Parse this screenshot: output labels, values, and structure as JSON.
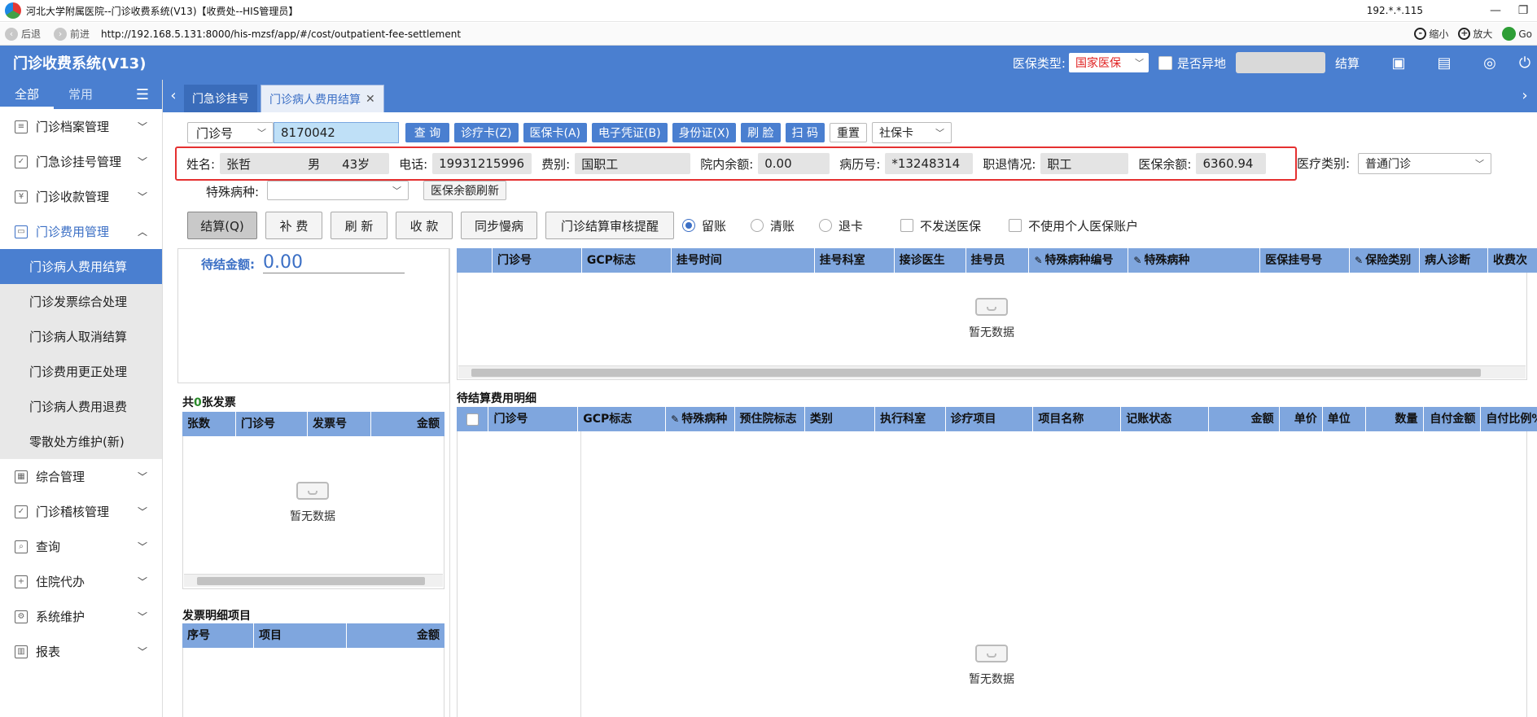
{
  "window": {
    "title": "河北大学附属医院--门诊收费系统(V13)【收费处--HIS管理员】",
    "ip": "192.*.*.115"
  },
  "addr": {
    "back": "后退",
    "forward": "前进",
    "url": "http://192.168.5.131:8000/his-mzsf/app/#/cost/outpatient-fee-settlement",
    "zoom_out": "缩小",
    "zoom_in": "放大",
    "go": "Go"
  },
  "header": {
    "title": "门诊收费系统(V13)",
    "insurance_type_label": "医保类型:",
    "insurance_type_value": "国家医保",
    "remote_label": "是否异地",
    "settle_label": "结算"
  },
  "sidebar": {
    "tabs": [
      "全部",
      "常用"
    ],
    "menu": [
      {
        "label": "门诊档案管理"
      },
      {
        "label": "门急诊挂号管理"
      },
      {
        "label": "门诊收款管理"
      },
      {
        "label": "门诊费用管理"
      }
    ],
    "sub": [
      "门诊病人费用结算",
      "门诊发票综合处理",
      "门诊病人取消结算",
      "门诊费用更正处理",
      "门诊病人费用退费",
      "零散处方维护(新)"
    ],
    "menu2": [
      {
        "label": "综合管理"
      },
      {
        "label": "门诊稽核管理"
      },
      {
        "label": "查询"
      },
      {
        "label": "住院代办"
      },
      {
        "label": "系统维护"
      },
      {
        "label": "报表"
      }
    ]
  },
  "tabs": [
    "门急诊挂号",
    "门诊病人费用结算"
  ],
  "toolbar": {
    "search_type": "门诊号",
    "search_value": "8170042",
    "buttons": [
      "查 询",
      "诊疗卡(Z)",
      "医保卡(A)",
      "电子凭证(B)",
      "身份证(X)",
      "刷 脸",
      "扫 码"
    ],
    "reset": "重置",
    "card_type": "社保卡"
  },
  "patient": {
    "name_label": "姓名:",
    "name": "张哲",
    "sex": "男",
    "age": "43岁",
    "phone_label": "电话:",
    "phone": "19931215996",
    "fee_label": "费别:",
    "fee_type": "国职工",
    "balance_label": "院内余额:",
    "balance": "0.00",
    "record_label": "病历号:",
    "record_no": "*13248314",
    "retire_label": "职退情况:",
    "retire": "职工",
    "ins_balance_label": "医保余额:",
    "ins_balance": "6360.94",
    "med_type_label": "医疗类别:",
    "med_type": "普通门诊",
    "special_label": "特殊病种:",
    "refresh_ins": "医保余额刷新"
  },
  "actions": {
    "buttons": [
      "结算(Q)",
      "补 费",
      "刷 新",
      "收 款",
      "同步慢病",
      "门诊结算审核提醒"
    ],
    "radios": [
      "留账",
      "清账",
      "退卡"
    ],
    "checks": [
      "不发送医保",
      "不使用个人医保账户"
    ]
  },
  "pending": {
    "label": "待结金额:",
    "value": "0.00"
  },
  "reg_grid": {
    "headers": [
      "门诊号",
      "GCP标志",
      "挂号时间",
      "挂号科室",
      "接诊医生",
      "挂号员",
      "特殊病种编号",
      "特殊病种",
      "医保挂号号",
      "保险类别",
      "病人诊断",
      "收费次"
    ],
    "empty": "暂无数据"
  },
  "invoice": {
    "title_prefix": "共",
    "count": "0",
    "title_suffix": "张发票",
    "headers": [
      "张数",
      "门诊号",
      "发票号",
      "金额"
    ],
    "empty": "暂无数据"
  },
  "invoice_detail": {
    "title": "发票明细项目",
    "headers": [
      "序号",
      "项目",
      "金额"
    ]
  },
  "fee_detail": {
    "title": "待结算费用明细",
    "headers": [
      "门诊号",
      "GCP标志",
      "特殊病种",
      "预住院标志",
      "类别",
      "执行科室",
      "诊疗项目",
      "项目名称",
      "记账状态",
      "金额",
      "单价",
      "单位",
      "数量",
      "自付金额",
      "自付比例%"
    ],
    "empty": "暂无数据"
  }
}
